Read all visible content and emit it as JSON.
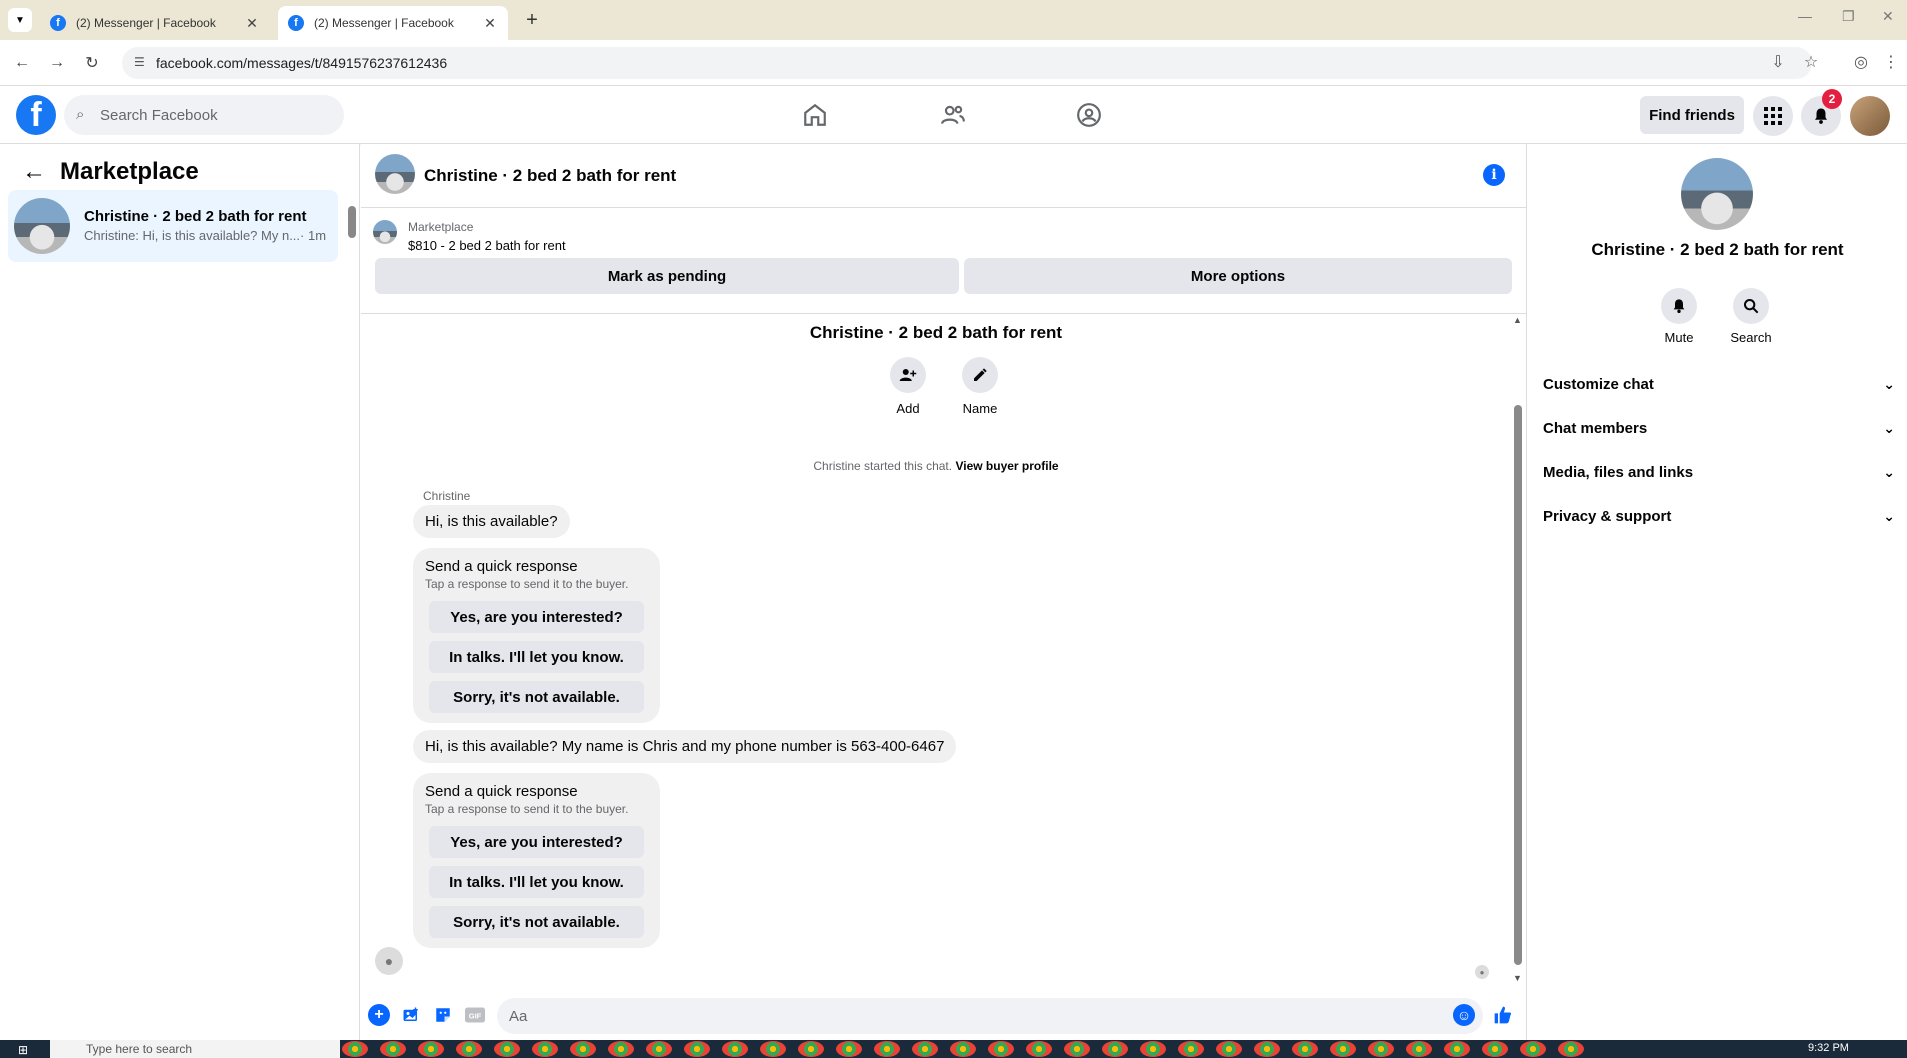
{
  "browser": {
    "tabs": [
      {
        "title": "(2) Messenger | Facebook",
        "active": false
      },
      {
        "title": "(2) Messenger | Facebook",
        "active": true
      }
    ],
    "url": "facebook.com/messages/t/8491576237612436"
  },
  "header": {
    "search_placeholder": "Search Facebook",
    "find_friends_label": "Find friends",
    "notification_count": "2",
    "nav_icons": [
      "home-icon",
      "friends-icon",
      "groups-icon"
    ]
  },
  "sidebar": {
    "title": "Marketplace",
    "conversations": [
      {
        "name": "Christine · 2 bed 2 bath for rent",
        "preview": "Christine: Hi, is this available? My n...",
        "time": "· 1m"
      }
    ]
  },
  "chat": {
    "title": "Christine · 2 bed 2 bath for rent",
    "listing": {
      "label": "Marketplace",
      "price_title": "$810 - 2 bed 2 bath for rent",
      "mark_pending_label": "Mark as pending",
      "more_options_label": "More options"
    },
    "intro": {
      "name": "Christine · 2 bed 2 bath for rent",
      "add_label": "Add",
      "name_label": "Name",
      "started_text": "Christine started this chat.",
      "view_buyer_label": "View buyer profile"
    },
    "sender_name": "Christine",
    "messages": [
      {
        "text": "Hi, is this available?"
      },
      {
        "text": "Hi, is this available? My name is Chris and my phone number is 563-400-6467"
      }
    ],
    "quick_response": {
      "title": "Send a quick response",
      "subtitle": "Tap a response to send it to the buyer.",
      "options": [
        "Yes, are you interested?",
        "In talks. I'll let you know.",
        "Sorry, it's not available."
      ]
    },
    "composer_placeholder": "Aa"
  },
  "details": {
    "name": "Christine · 2 bed 2 bath for rent",
    "mute_label": "Mute",
    "search_label": "Search",
    "sections": [
      "Customize chat",
      "Chat members",
      "Media, files and links",
      "Privacy & support"
    ]
  },
  "taskbar": {
    "search_placeholder": "Type here to search",
    "time": "9:32 PM"
  },
  "colors": {
    "brand": "#1877f2",
    "messenger_blue": "#0866ff",
    "selected_conversation": "#ebf5ff",
    "badge": "#e41e3f"
  }
}
